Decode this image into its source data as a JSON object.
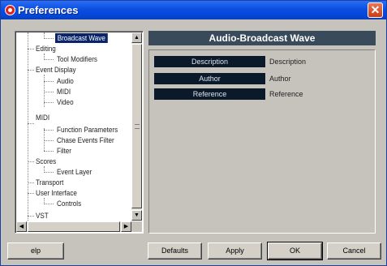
{
  "window": {
    "title": "Preferences",
    "close_glyph": "✕"
  },
  "tree": {
    "items": [
      {
        "label": "Broadcast Wave",
        "level": 2,
        "selected": true
      },
      {
        "label": "Editing",
        "level": 1
      },
      {
        "label": "Tool Modifiers",
        "level": 2
      },
      {
        "label": "Event Display",
        "level": 1
      },
      {
        "label": "Audio",
        "level": 2
      },
      {
        "label": "MIDI",
        "level": 2
      },
      {
        "label": "Video",
        "level": 2
      },
      {
        "label": "MIDI",
        "level": 1
      },
      {
        "label": "Function Parameters",
        "level": 2
      },
      {
        "label": "Chase Events Filter",
        "level": 2
      },
      {
        "label": "Filter",
        "level": 2
      },
      {
        "label": "Scores",
        "level": 1
      },
      {
        "label": "Event Layer",
        "level": 2
      },
      {
        "label": "Transport",
        "level": 1
      },
      {
        "label": "User Interface",
        "level": 1
      },
      {
        "label": "Controls",
        "level": 2
      },
      {
        "label": "VST",
        "level": 1
      }
    ],
    "scroll_up_glyph": "▲",
    "scroll_down_glyph": "▼",
    "scroll_left_glyph": "◀",
    "scroll_right_glyph": "▶"
  },
  "panel": {
    "title": "Audio-Broadcast Wave",
    "fields": [
      {
        "label": "Description",
        "value": "Description"
      },
      {
        "label": "Author",
        "value": "Author"
      },
      {
        "label": "Reference",
        "value": "Reference"
      }
    ]
  },
  "buttons": {
    "help": "elp",
    "defaults": "Defaults",
    "apply": "Apply",
    "ok": "OK",
    "cancel": "Cancel"
  },
  "colors": {
    "titlebar": "#0a4fe0",
    "panel_header": "#394a5a",
    "field_label_bg": "#0b1a2b",
    "selection": "#0a246a"
  }
}
